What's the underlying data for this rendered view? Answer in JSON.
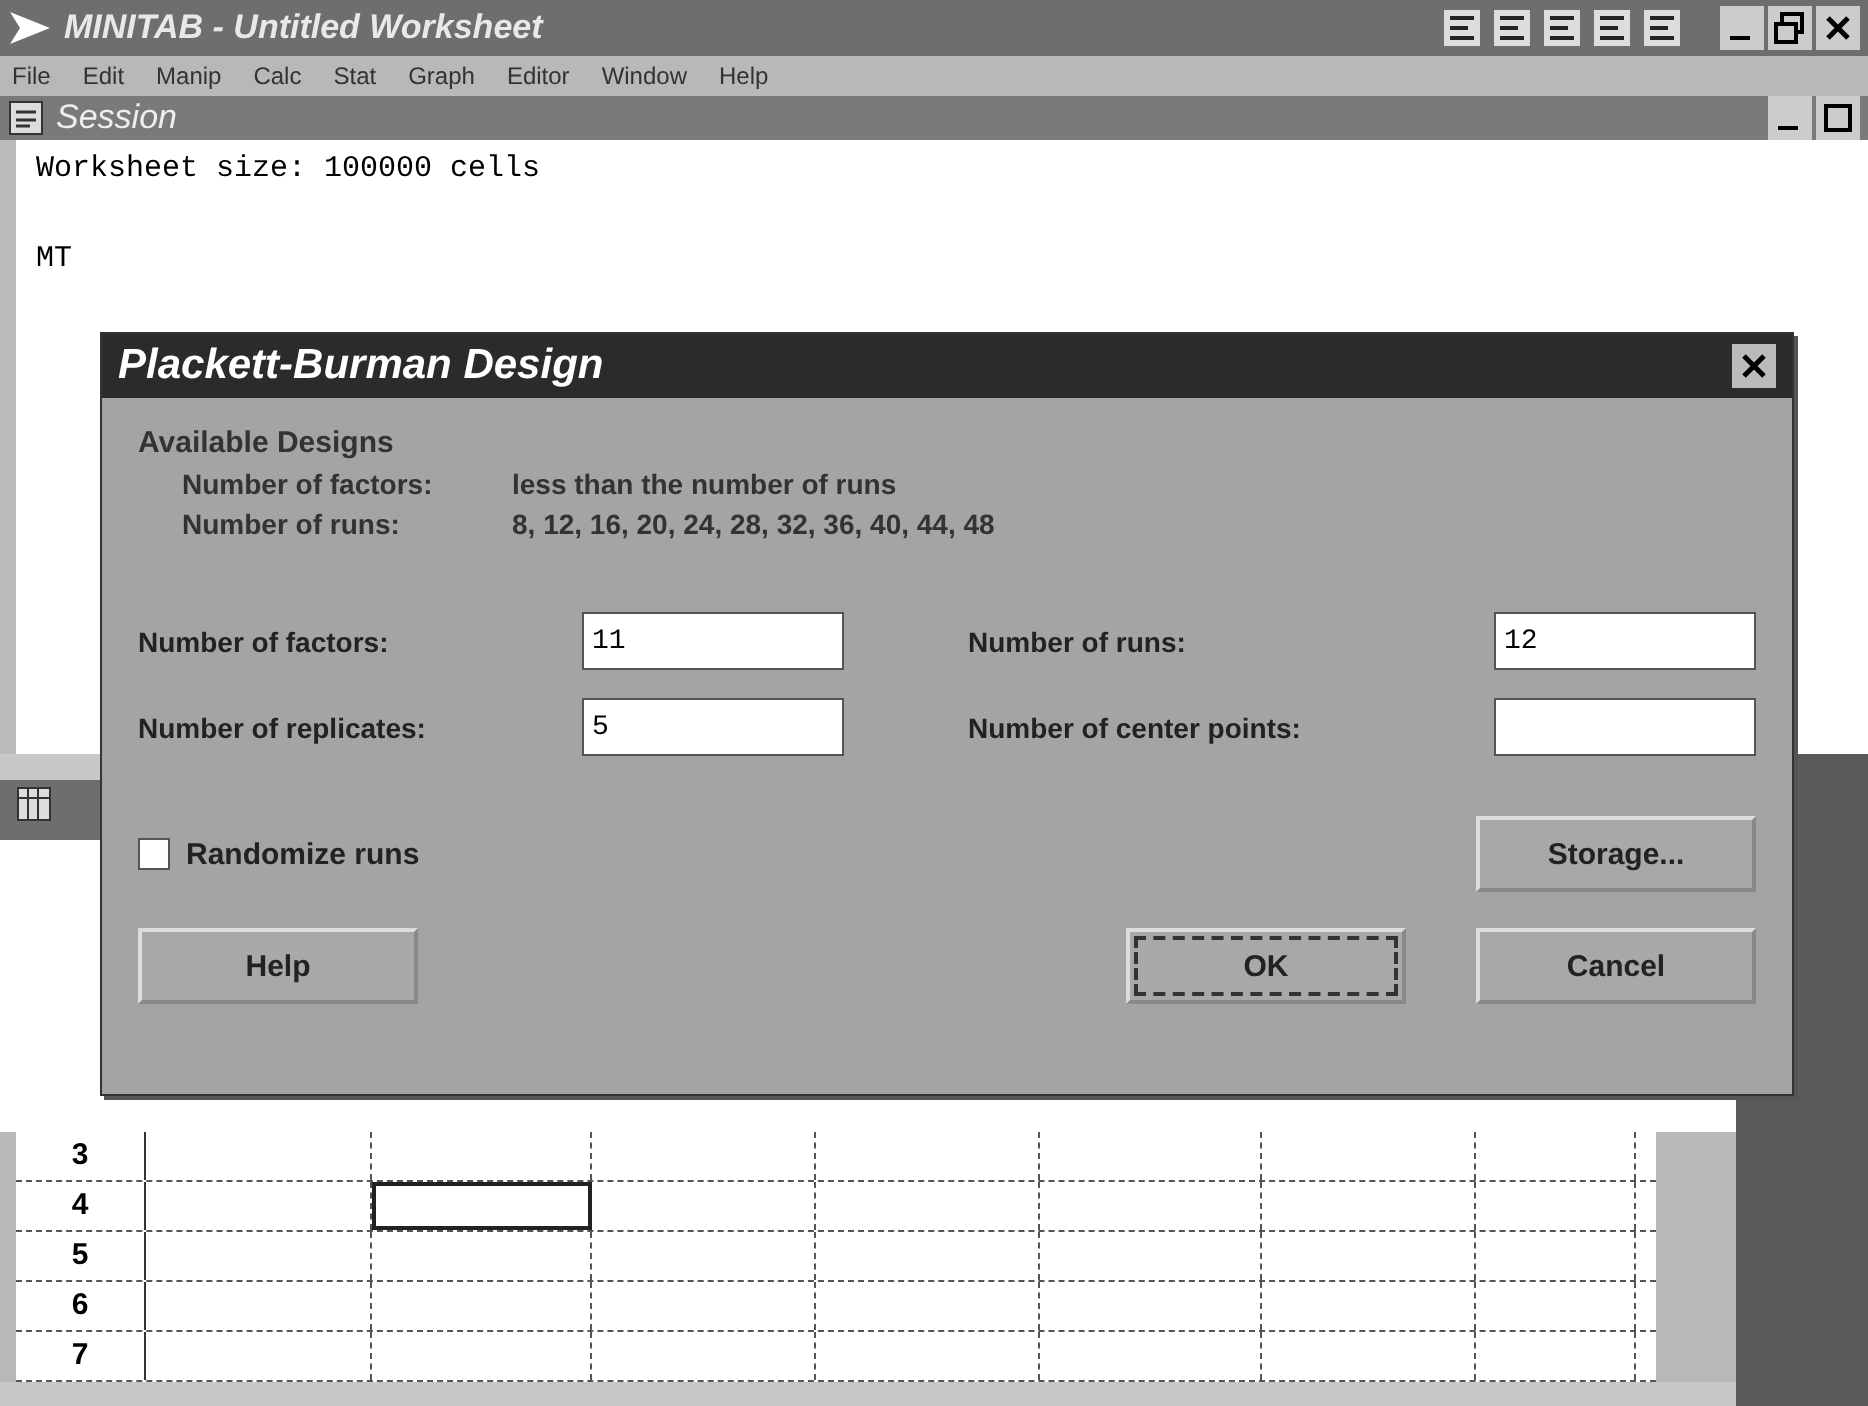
{
  "app": {
    "title": "MINITAB - Untitled Worksheet",
    "menu": [
      "File",
      "Edit",
      "Manip",
      "Calc",
      "Stat",
      "Graph",
      "Editor",
      "Window",
      "Help"
    ]
  },
  "session": {
    "title": "Session",
    "lines": [
      "Worksheet size: 100000 cells",
      "MT"
    ]
  },
  "worksheet": {
    "rows": [
      {
        "label": "3",
        "cells": [
          false,
          false,
          false,
          false,
          false,
          false,
          false
        ]
      },
      {
        "label": "4",
        "cells": [
          false,
          true,
          false,
          false,
          false,
          false,
          false
        ]
      },
      {
        "label": "5",
        "cells": [
          false,
          false,
          false,
          false,
          false,
          false,
          false
        ]
      },
      {
        "label": "6",
        "cells": [
          false,
          false,
          false,
          false,
          false,
          false,
          false
        ]
      },
      {
        "label": "7",
        "cells": [
          false,
          false,
          false,
          false,
          false,
          false,
          false
        ]
      }
    ]
  },
  "dialog": {
    "title": "Plackett-Burman Design",
    "section": "Available Designs",
    "info": [
      {
        "label": "Number of factors:",
        "value": "less than the number of runs"
      },
      {
        "label": "Number of runs:",
        "value": "8, 12, 16, 20, 24, 28, 32, 36, 40, 44, 48"
      }
    ],
    "fields": [
      {
        "label": "Number of factors:",
        "value": "11"
      },
      {
        "label": "Number of runs:",
        "value": "12"
      },
      {
        "label": "Number of replicates:",
        "value": "5"
      },
      {
        "label": "Number of center points:"
      }
    ],
    "checkbox": {
      "label": "Randomize runs",
      "checked": false
    },
    "storage_button": {
      "label": "Storage...",
      "focused": false
    },
    "buttons": [
      {
        "label": "Help",
        "focused": false
      },
      {
        "label": "OK",
        "focused": true
      },
      {
        "label": "Cancel",
        "focused": false
      }
    ]
  }
}
